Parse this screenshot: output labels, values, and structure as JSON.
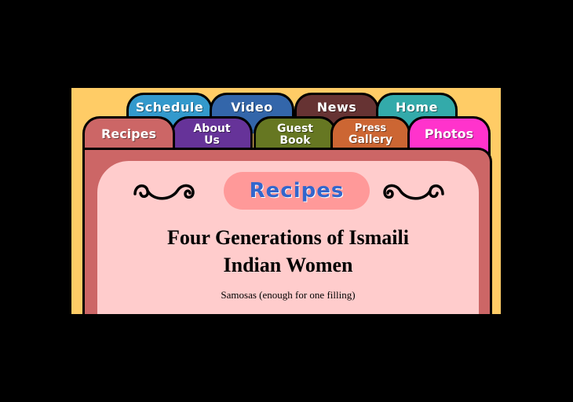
{
  "tabs_back": [
    {
      "label": "Schedule",
      "color": "#3399cc"
    },
    {
      "label": "Video",
      "color": "#3366aa"
    },
    {
      "label": "News",
      "color": "#663333"
    },
    {
      "label": "Home",
      "color": "#33aaaa"
    }
  ],
  "tabs_front": [
    {
      "label": "Recipes",
      "color": "#cc6666"
    },
    {
      "label_line1": "About",
      "label_line2": "Us",
      "color": "#663399"
    },
    {
      "label_line1": "Guest",
      "label_line2": "Book",
      "color": "#667722"
    },
    {
      "label_line1": "Press",
      "label_line2": "Gallery",
      "color": "#cc6633"
    },
    {
      "label": "Photos",
      "color": "#ff33cc"
    }
  ],
  "page": {
    "section_title": "Recipes",
    "heading_line1": "Four Generations of Ismaili",
    "heading_line2": "Indian Women",
    "subtext": "Samosas (enough for one filling)"
  },
  "colors": {
    "background": "#000000",
    "stage": "#ffcc66",
    "card": "#cc6666",
    "card_inner": "#ffcccc",
    "title_pill": "#ff9999",
    "title_text": "#3366cc"
  }
}
